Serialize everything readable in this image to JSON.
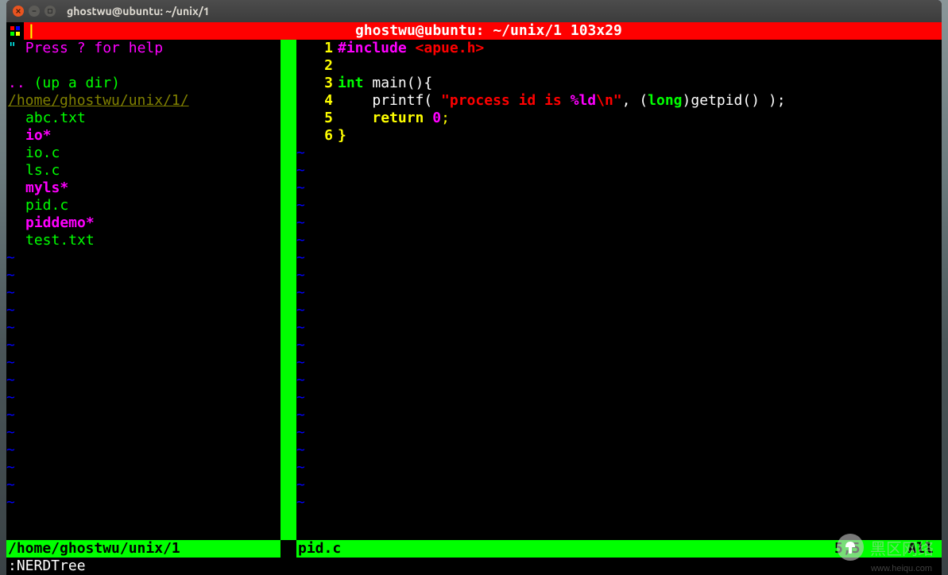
{
  "window": {
    "title": "ghostwu@ubuntu: ~/unix/1"
  },
  "header": {
    "text": "ghostwu@ubuntu: ~/unix/1 103x29"
  },
  "nerdtree": {
    "help": "Press ? for help",
    "updir": "(up a dir)",
    "path": "/home/ghostwu/unix/1/",
    "files": [
      {
        "name": "abc.txt",
        "style": "file-green"
      },
      {
        "name": "io*",
        "style": "file-magenta"
      },
      {
        "name": "io.c",
        "style": "file-green"
      },
      {
        "name": "ls.c",
        "style": "file-green"
      },
      {
        "name": "myls*",
        "style": "file-magenta"
      },
      {
        "name": "pid.c",
        "style": "file-green"
      },
      {
        "name": "piddemo*",
        "style": "file-magenta"
      },
      {
        "name": "test.txt",
        "style": "file-green"
      }
    ]
  },
  "code": {
    "lines": [
      {
        "n": "1",
        "tokens": [
          [
            "kw-pre",
            "#include "
          ],
          [
            "hdr",
            "<apue.h>"
          ]
        ]
      },
      {
        "n": "2",
        "tokens": []
      },
      {
        "n": "3",
        "tokens": [
          [
            "kw-type",
            "int"
          ],
          [
            "plain",
            " main(){"
          ]
        ]
      },
      {
        "n": "4",
        "tokens": [
          [
            "plain",
            "    printf( "
          ],
          [
            "str",
            "\"process id is "
          ],
          [
            "fmt",
            "%ld"
          ],
          [
            "str",
            "\\n\""
          ],
          [
            "plain",
            ", ("
          ],
          [
            "kw-type",
            "long"
          ],
          [
            "plain",
            ")getpid() );"
          ]
        ]
      },
      {
        "n": "5",
        "tokens": [
          [
            "plain",
            "    "
          ],
          [
            "kw-ret",
            "return"
          ],
          [
            "plain",
            " "
          ],
          [
            "num",
            "0"
          ],
          [
            "semi",
            ";"
          ]
        ]
      },
      {
        "n": "6",
        "tokens": [
          [
            "brace",
            "}"
          ]
        ]
      }
    ]
  },
  "status": {
    "left": "/home/ghostwu/unix/1",
    "file": "pid.c",
    "pos": "5,5",
    "pct": "All"
  },
  "cmd": ":NERDTree",
  "watermark": {
    "text": "黑区网络",
    "sub": "www.heiqu.com"
  }
}
